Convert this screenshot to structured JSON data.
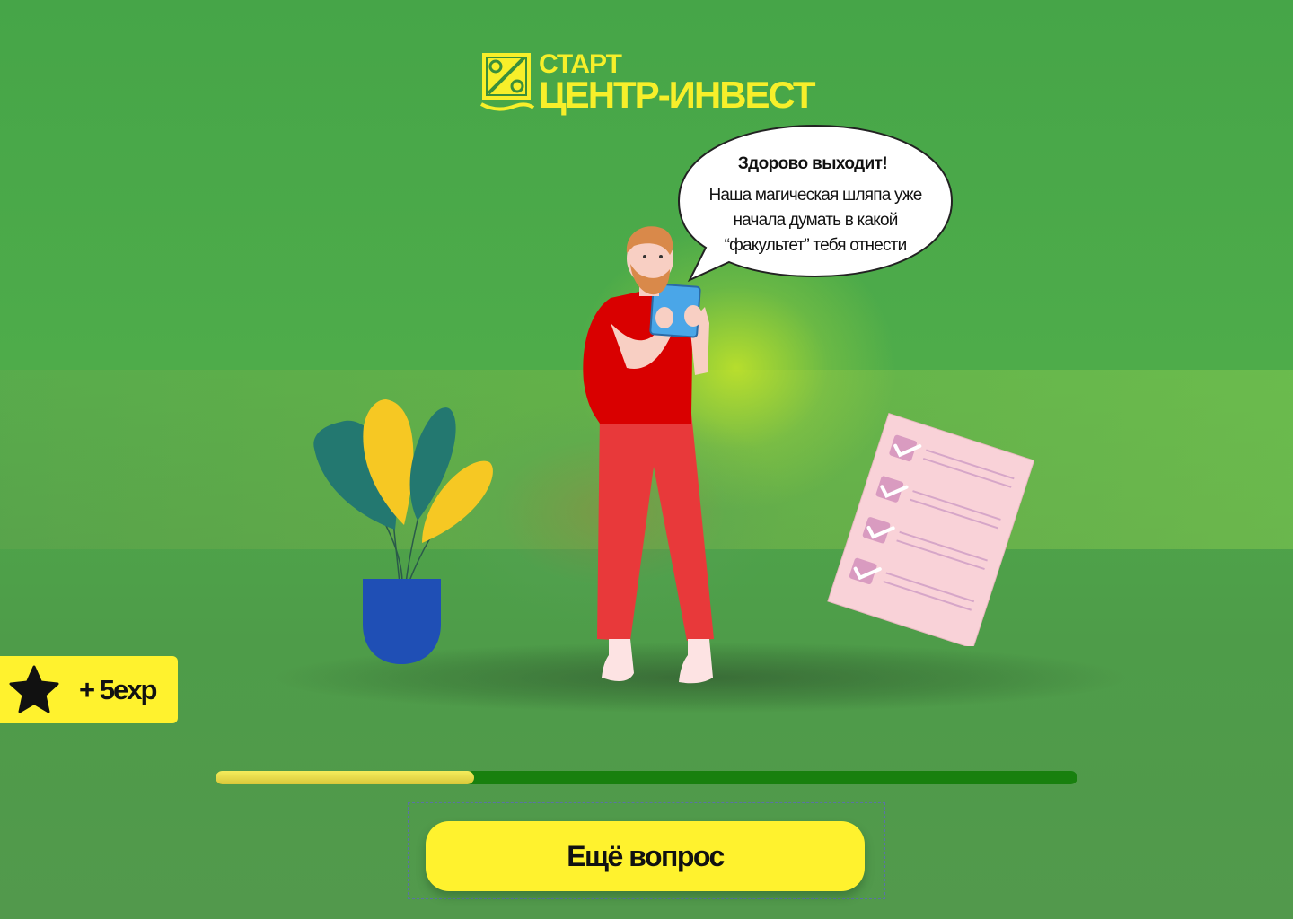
{
  "brand": {
    "line1": "СТАРТ",
    "line2": "ЦЕНТР-ИНВЕСТ",
    "color": "#f7ef2a"
  },
  "speech_bubble": {
    "title": "Здорово выходит!",
    "text": "Наша магическая шляпа уже начала думать в какой “факультет” тебя отнести"
  },
  "reward": {
    "icon": "star-icon",
    "label": "+ 5exp",
    "color": "#fff22e"
  },
  "progress": {
    "value": 0.3,
    "track_color": "#18800e",
    "fill_color": "#e8dc4a"
  },
  "actions": {
    "next_label": "Ещё вопрос",
    "button_color": "#fff22e"
  },
  "illustrations": {
    "plant": "potted-plant-illustration",
    "person": "man-with-tablet-illustration",
    "checklist": "checklist-paper-illustration"
  }
}
